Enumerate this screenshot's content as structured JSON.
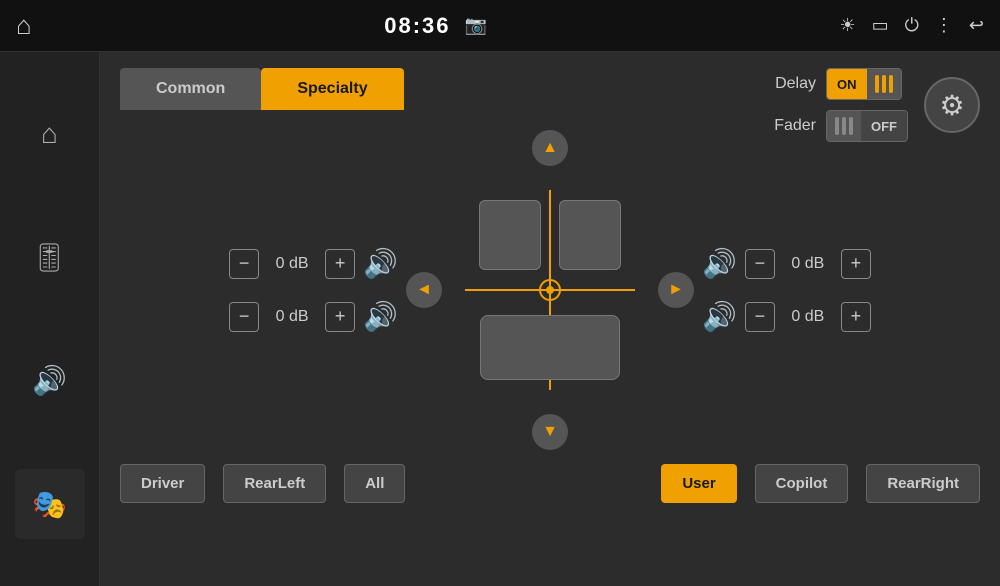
{
  "statusBar": {
    "time": "08:36",
    "icons": [
      "camera",
      "brightness",
      "battery",
      "power",
      "menu",
      "back"
    ]
  },
  "sidebar": {
    "items": [
      {
        "id": "home",
        "icon": "⌂",
        "active": false
      },
      {
        "id": "equalizer",
        "icon": "🎛",
        "active": false
      },
      {
        "id": "volume",
        "icon": "🔊",
        "active": false
      },
      {
        "id": "audio-effect",
        "icon": "🎭",
        "active": true
      }
    ]
  },
  "tabs": {
    "common": {
      "label": "Common",
      "active": false
    },
    "specialty": {
      "label": "Specialty",
      "active": true
    }
  },
  "topControls": {
    "delay": {
      "label": "Delay",
      "state": "ON"
    },
    "fader": {
      "label": "Fader",
      "state": "OFF"
    }
  },
  "leftControls": {
    "top": {
      "value": "0 dB"
    },
    "bottom": {
      "value": "0 dB"
    }
  },
  "rightControls": {
    "top": {
      "value": "0 dB"
    },
    "bottom": {
      "value": "0 dB"
    }
  },
  "zoneButtons": [
    {
      "id": "driver",
      "label": "Driver",
      "active": false
    },
    {
      "id": "rearleft",
      "label": "RearLeft",
      "active": false
    },
    {
      "id": "all",
      "label": "All",
      "active": false
    },
    {
      "id": "user",
      "label": "User",
      "active": true
    },
    {
      "id": "copilot",
      "label": "Copilot",
      "active": false
    },
    {
      "id": "rearright",
      "label": "RearRight",
      "active": false
    }
  ],
  "buttons": {
    "minus": "−",
    "plus": "+",
    "arrowUp": "▲",
    "arrowDown": "▼",
    "arrowLeft": "◄",
    "arrowRight": "►"
  }
}
